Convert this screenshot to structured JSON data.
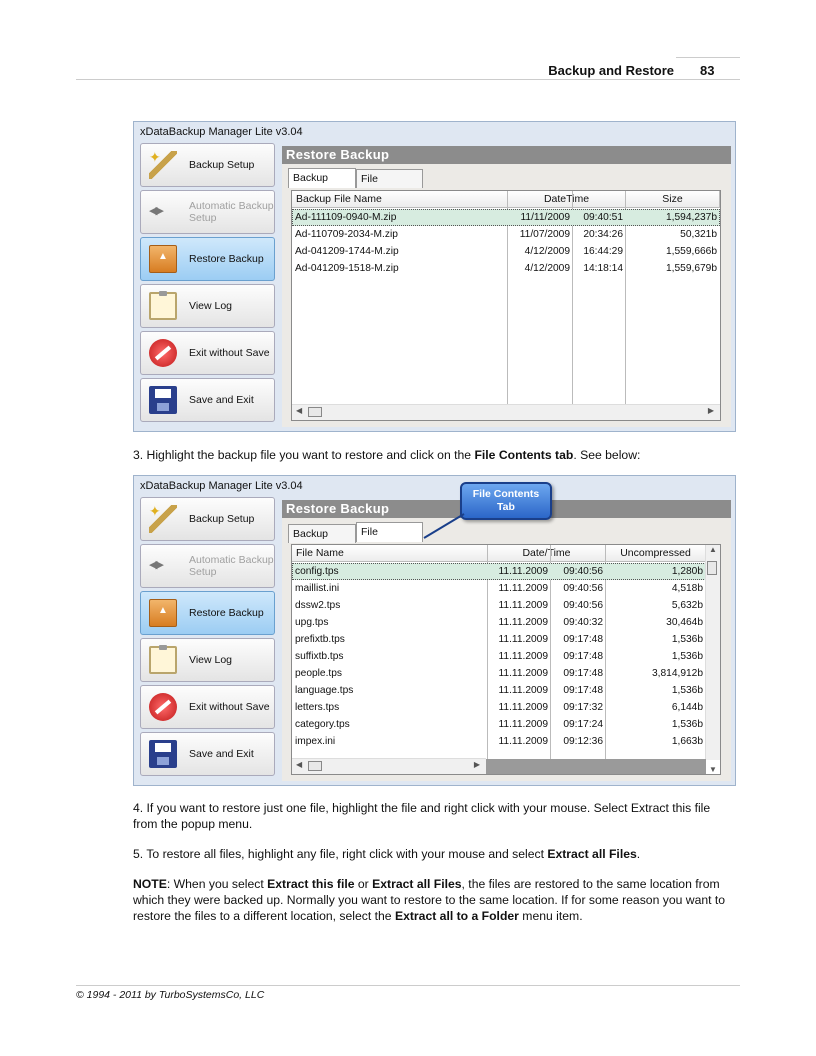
{
  "header": {
    "title": "Backup and Restore",
    "page": "83"
  },
  "footer": "© 1994 - 2011 by TurboSystemsCo, LLC",
  "window_title": "xDataBackup Manager Lite v3.04",
  "sidebar": {
    "backup_setup": "Backup Setup",
    "automatic_backup_1": "Automatic Backup",
    "automatic_backup_2": "Setup",
    "restore_backup": "Restore Backup",
    "view_log": "View Log",
    "exit_without_save": "Exit without Save",
    "save_and_exit": "Save and Exit"
  },
  "panel_title": "Restore Backup",
  "tabs": {
    "backup_files": "Backup Files",
    "file_contents": "File contents"
  },
  "backup_list": {
    "headers": [
      "Backup File Name",
      "DateTime",
      "Size"
    ],
    "rows": [
      [
        "Ad-111109-0940-M.zip",
        "11/11/2009",
        "09:40:51",
        "1,594,237b"
      ],
      [
        "Ad-110709-2034-M.zip",
        "11/07/2009",
        "20:34:26",
        "50,321b"
      ],
      [
        "Ad-041209-1744-M.zip",
        "4/12/2009",
        "16:44:29",
        "1,559,666b"
      ],
      [
        "Ad-041209-1518-M.zip",
        "4/12/2009",
        "14:18:14",
        "1,559,679b"
      ]
    ]
  },
  "instruction_3": {
    "before": "3. Highlight the backup file you want to restore and click on the ",
    "bold": "File Contents tab",
    "after": ". See below:"
  },
  "callout": {
    "line1": "File Contents",
    "line2": "Tab"
  },
  "contents_list": {
    "headers": [
      "File Name",
      "Date/Time",
      "Uncompressed Size"
    ],
    "rows": [
      [
        "config.tps",
        "11.11.2009",
        "09:40:56",
        "1,280b"
      ],
      [
        "maillist.ini",
        "11.11.2009",
        "09:40:56",
        "4,518b"
      ],
      [
        "dssw2.tps",
        "11.11.2009",
        "09:40:56",
        "5,632b"
      ],
      [
        "upg.tps",
        "11.11.2009",
        "09:40:32",
        "30,464b"
      ],
      [
        "prefixtb.tps",
        "11.11.2009",
        "09:17:48",
        "1,536b"
      ],
      [
        "suffixtb.tps",
        "11.11.2009",
        "09:17:48",
        "1,536b"
      ],
      [
        "people.tps",
        "11.11.2009",
        "09:17:48",
        "3,814,912b"
      ],
      [
        "language.tps",
        "11.11.2009",
        "09:17:48",
        "1,536b"
      ],
      [
        "letters.tps",
        "11.11.2009",
        "09:17:32",
        "6,144b"
      ],
      [
        "category.tps",
        "11.11.2009",
        "09:17:24",
        "1,536b"
      ],
      [
        "impex.ini",
        "11.11.2009",
        "09:12:36",
        "1,663b"
      ]
    ]
  },
  "instruction_4": "4. If you want to restore just one file, highlight the file and right click with your mouse. Select Extract this file from the popup menu.",
  "instruction_5": {
    "before": "5. To restore all files, highlight any file, right click with your mouse and select ",
    "bold": "Extract all Files",
    "after": "."
  },
  "note": {
    "label": "NOTE",
    "t1": ": When you select ",
    "b1": "Extract this file",
    "t2": " or ",
    "b2": "Extract all Files",
    "t3": ", the files are restored to the same location from which they were backed up. Normally you want to restore to the same location. If for some reason you want to restore the files to a different location, select the ",
    "b3": "Extract all to a Folder",
    "t4": " menu item."
  }
}
